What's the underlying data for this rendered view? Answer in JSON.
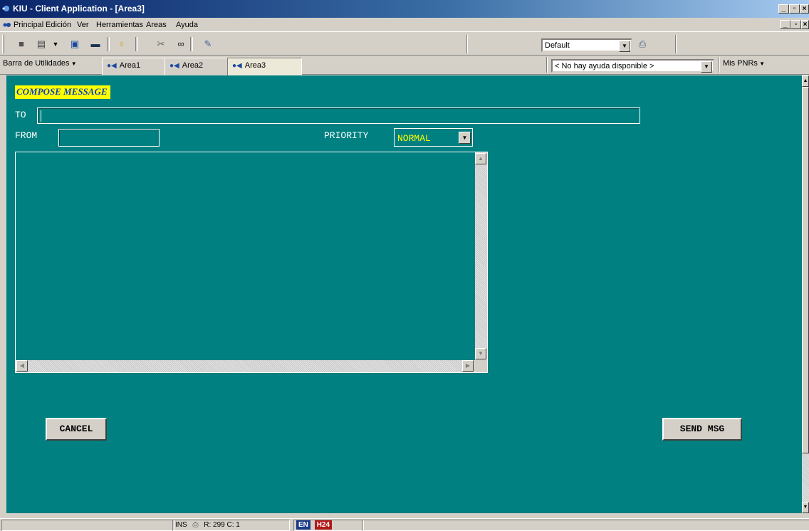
{
  "window": {
    "title": "KIU  -  Client Application - [Area3]",
    "caption_buttons": [
      "_",
      "□",
      "×"
    ]
  },
  "menu": {
    "items": [
      "Principal",
      "Edición",
      "Ver",
      "Herramientas",
      "Areas",
      "Ayuda"
    ]
  },
  "toolbar": {
    "profile_combo": "Default"
  },
  "tabs": {
    "utilities_label": "Barra de Utilidades",
    "items": [
      "Area1",
      "Area2",
      "Area3"
    ],
    "active": "Area3",
    "help_combo": "< No hay ayuda disponible >",
    "pnrs_label": "Mis PNRs"
  },
  "compose": {
    "title": "COMPOSE MESSAGE",
    "to_label": "TO",
    "to_value": "",
    "from_label": "FROM",
    "from_value": "",
    "priority_label": "PRIORITY",
    "priority_value": "NORMAL",
    "body_value": "",
    "cancel_label": "CANCEL",
    "send_label": "SEND MSG"
  },
  "status": {
    "mode": "INS",
    "position": "R: 299 C:  1",
    "lang": "EN",
    "clock": "H24"
  },
  "colors": {
    "background": "#008080",
    "title_highlight": "#ffff00",
    "priority_text": "#ffff00"
  }
}
